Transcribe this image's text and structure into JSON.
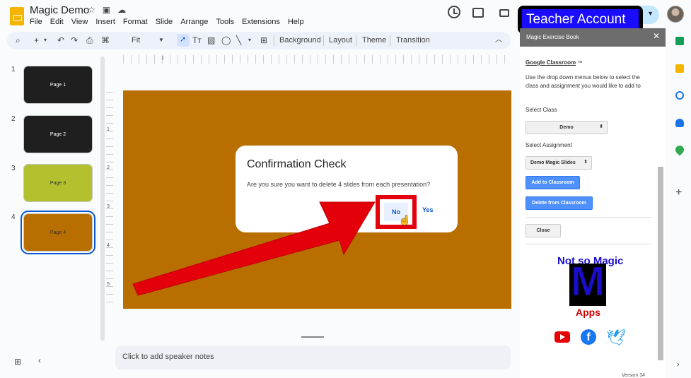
{
  "app": {
    "doc_title": "Magic Demo",
    "menu": [
      "File",
      "Edit",
      "View",
      "Insert",
      "Format",
      "Slide",
      "Arrange",
      "Tools",
      "Extensions",
      "Help"
    ]
  },
  "banner": {
    "text": "Teacher Account"
  },
  "toolbar": {
    "zoom": "Fit",
    "background": "Background",
    "layout": "Layout",
    "theme": "Theme",
    "transition": "Transition"
  },
  "slides": [
    {
      "num": "1",
      "label": "Page 1",
      "bg": "#1f1f1f",
      "fg": "#ffffff"
    },
    {
      "num": "2",
      "label": "Page 2",
      "bg": "#1f1f1f",
      "fg": "#ffffff"
    },
    {
      "num": "3",
      "label": "Page 3",
      "bg": "#b3c12f",
      "fg": "#333333"
    },
    {
      "num": "4",
      "label": "Page 4",
      "bg": "#b96e00",
      "fg": "#333333"
    }
  ],
  "ruler": {
    "top": [
      "1"
    ],
    "left": [
      "1",
      "2",
      "3",
      "4",
      "5"
    ]
  },
  "notes": {
    "placeholder": "Click to add speaker notes"
  },
  "dialog": {
    "title": "Confirmation Check",
    "message": "Are you sure you want to delete 4 slides from each presentation?",
    "no_label": "No",
    "yes_label": "Yes"
  },
  "panel": {
    "header": "Magic Exercise Book",
    "section_title": "Google Classroom",
    "tm": "™",
    "intro": "Use the drop down menus below to select the class and assignment you would like to add to",
    "class_label": "Select Class",
    "class_value": "Demo",
    "assignment_label": "Select Assignment",
    "assignment_value": "Demo Magic Slides",
    "add_button": "Add to Classroom",
    "delete_button": "Delete from Classroom",
    "close_button": "Close",
    "logo_line1": "Not so Magic",
    "logo_letter": "M",
    "logo_line2": "Apps",
    "version": "Version 34"
  },
  "colors": {
    "slide_bg": "#b96e00",
    "accent_blue": "#0b57d0",
    "annotation_red": "#e3000b",
    "banner_blue": "#1a0dff"
  }
}
